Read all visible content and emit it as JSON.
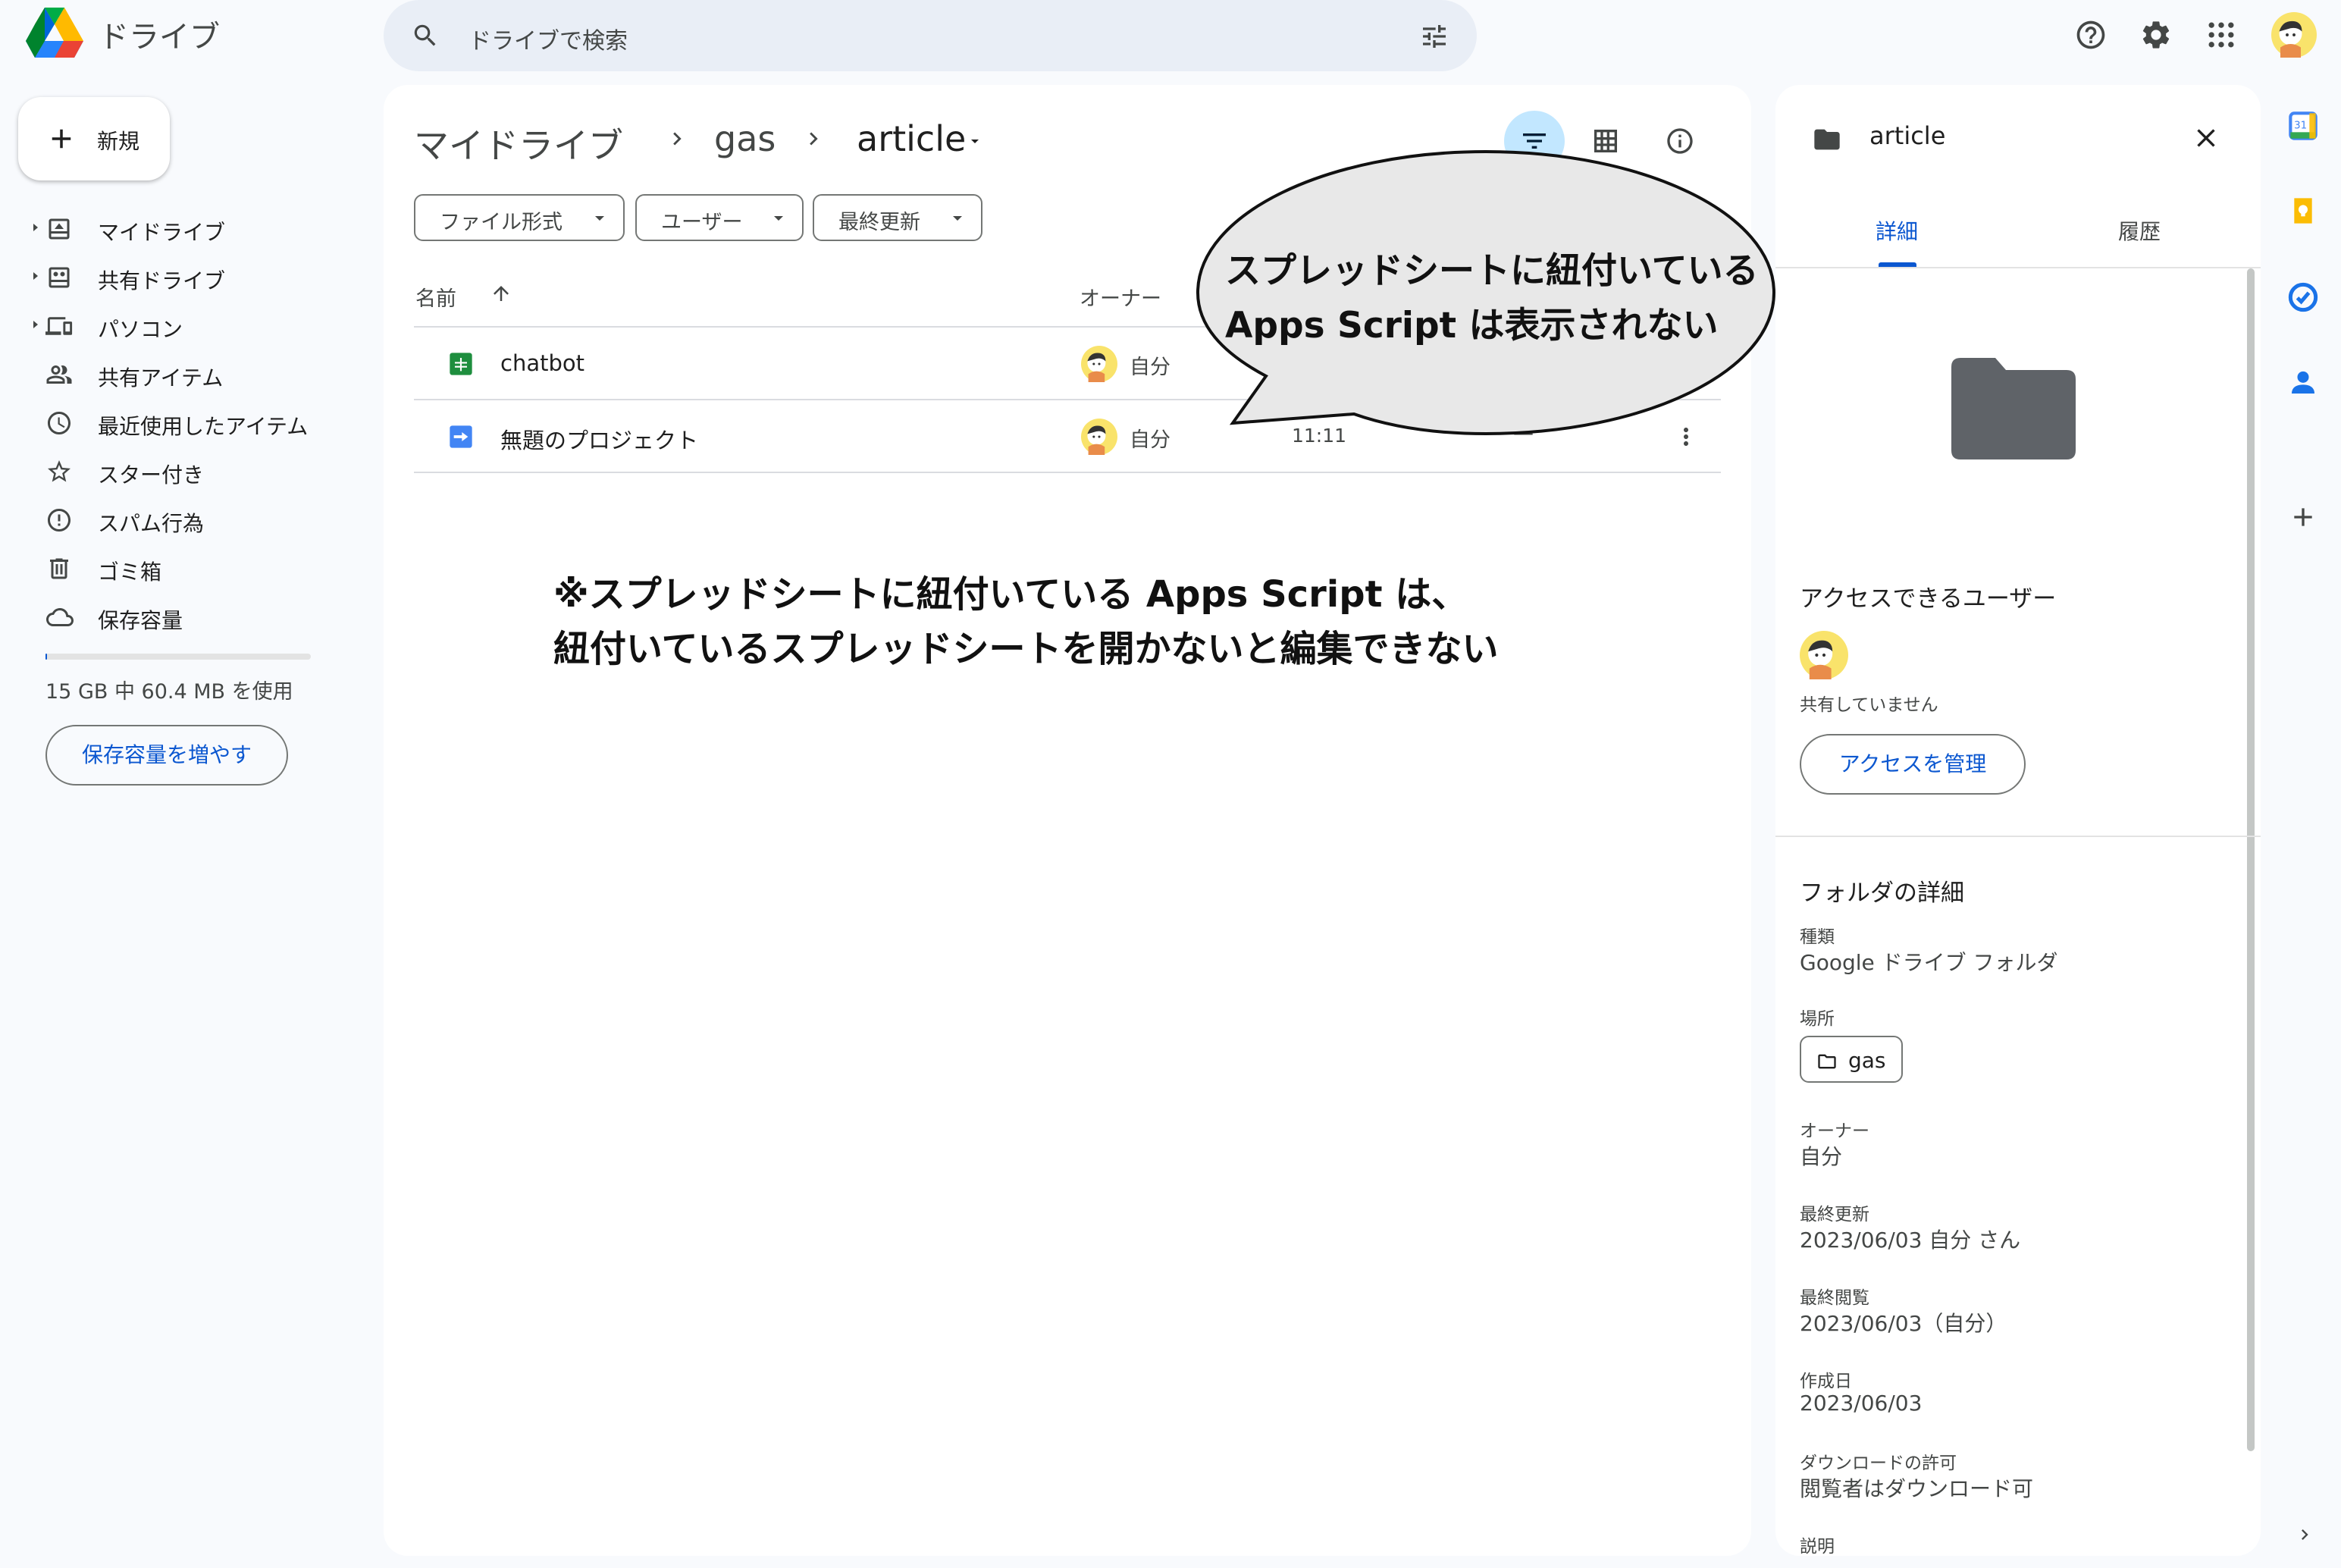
{
  "app": {
    "title": "ドライブ"
  },
  "search": {
    "placeholder": "ドライブで検索"
  },
  "nav": {
    "new_label": "新規",
    "items": [
      {
        "label": "マイドライブ",
        "icon": "my-drive-icon"
      },
      {
        "label": "共有ドライブ",
        "icon": "shared-drives-icon"
      },
      {
        "label": "パソコン",
        "icon": "computers-icon"
      },
      {
        "label": "共有アイテム",
        "icon": "people-icon"
      },
      {
        "label": "最近使用したアイテム",
        "icon": "clock-icon"
      },
      {
        "label": "スター付き",
        "icon": "star-icon"
      },
      {
        "label": "スパム行為",
        "icon": "spam-icon"
      },
      {
        "label": "ゴミ箱",
        "icon": "trash-icon"
      },
      {
        "label": "保存容量",
        "icon": "cloud-icon"
      }
    ],
    "storage_text": "15 GB 中 60.4 MB を使用",
    "storage_fraction": 0.004,
    "more_storage_label": "保存容量を増やす"
  },
  "breadcrumb": [
    "マイドライブ",
    "gas",
    "article"
  ],
  "filters": [
    "ファイル形式",
    "ユーザー",
    "最終更新"
  ],
  "table": {
    "headers": {
      "name": "名前",
      "owner": "オーナー"
    },
    "rows": [
      {
        "name": "chatbot",
        "owner": "自分",
        "modified": "",
        "size": "",
        "icon": "sheets-icon"
      },
      {
        "name": "無題のプロジェクト",
        "owner": "自分",
        "modified": "11:11",
        "size": "—",
        "icon": "apps-script-icon"
      }
    ]
  },
  "annotation": {
    "bubble": [
      "スプレッドシートに紐付いている",
      "Apps Script は表示されない"
    ],
    "note": [
      "※スプレッドシートに紐付いている Apps Script は、",
      "紐付いているスプレッドシートを開かないと編集できない"
    ]
  },
  "details": {
    "title": "article",
    "tabs": [
      "詳細",
      "履歴"
    ],
    "access_title": "アクセスできるユーザー",
    "not_shared": "共有していません",
    "manage_label": "アクセスを管理",
    "folder_details_title": "フォルダの詳細",
    "fields": {
      "type_label": "種類",
      "type_value": "Google ドライブ フォルダ",
      "location_label": "場所",
      "location_value": "gas",
      "owner_label": "オーナー",
      "owner_value": "自分",
      "modified_label": "最終更新",
      "modified_value": "2023/06/03 自分 さん",
      "opened_label": "最終閲覧",
      "opened_value": "2023/06/03（自分）",
      "created_label": "作成日",
      "created_value": "2023/06/03",
      "download_label": "ダウンロードの許可",
      "download_value": "閲覧者はダウンロード可",
      "description_label": "説明"
    }
  },
  "right_rail": {
    "calendar_day": "31"
  },
  "colors": {
    "accent": "#0b57d0",
    "selected_bg": "#c2e7ff",
    "page_bg": "#f8fafd"
  }
}
